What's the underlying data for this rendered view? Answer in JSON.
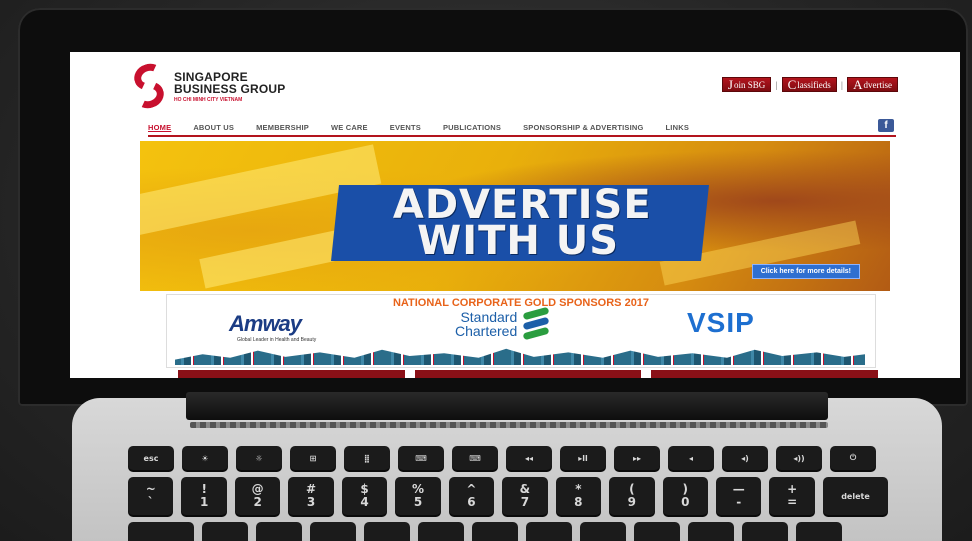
{
  "site": {
    "logo_line1": "SINGAPORE",
    "logo_line2": "BUSINESS GROUP",
    "logo_line3": "HO CHI MINH CITY VIETNAM"
  },
  "top_buttons": [
    {
      "initial": "J",
      "label": "oin SBG"
    },
    {
      "initial": "C",
      "label": "lassifieds"
    },
    {
      "initial": "A",
      "label": "dvertise"
    }
  ],
  "nav": [
    "HOME",
    "ABOUT US",
    "MEMBERSHIP",
    "WE CARE",
    "EVENTS",
    "PUBLICATIONS",
    "SPONSORSHIP & ADVERTISING",
    "LINKS"
  ],
  "facebook_icon": "f",
  "banner": {
    "line1": "ADVERTISE",
    "line2": "WITH US",
    "details_button": "Click here for more details!"
  },
  "sponsors": {
    "title": "NATIONAL CORPORATE GOLD SPONSORS 2017",
    "amway": "Amway",
    "amway_tag": "Global Leader in Health and Beauty",
    "sc_line1": "Standard",
    "sc_line2": "Chartered",
    "vsip": "VSIP"
  },
  "keyboard": {
    "fn_row": [
      "esc",
      "☀",
      "☼",
      "⊞",
      "⣿",
      "⌨",
      "⌨",
      "◂◂",
      "▸ll",
      "▸▸",
      "◂",
      "◂)",
      "◂))",
      "⏻"
    ],
    "num_row": [
      [
        "~",
        "`"
      ],
      [
        "!",
        "1"
      ],
      [
        "@",
        "2"
      ],
      [
        "#",
        "3"
      ],
      [
        "$",
        "4"
      ],
      [
        "%",
        "5"
      ],
      [
        "^",
        "6"
      ],
      [
        "&",
        "7"
      ],
      [
        "*",
        "8"
      ],
      [
        "(",
        "9"
      ],
      [
        ")",
        "0"
      ],
      [
        "—",
        "-"
      ],
      [
        "+",
        "="
      ],
      [
        "",
        "delete"
      ]
    ]
  },
  "colors": {
    "brand_red": "#c8102e",
    "nav_red": "#b3141d",
    "banner_blue": "#1a4fa8",
    "sponsor_orange": "#e8631a"
  }
}
